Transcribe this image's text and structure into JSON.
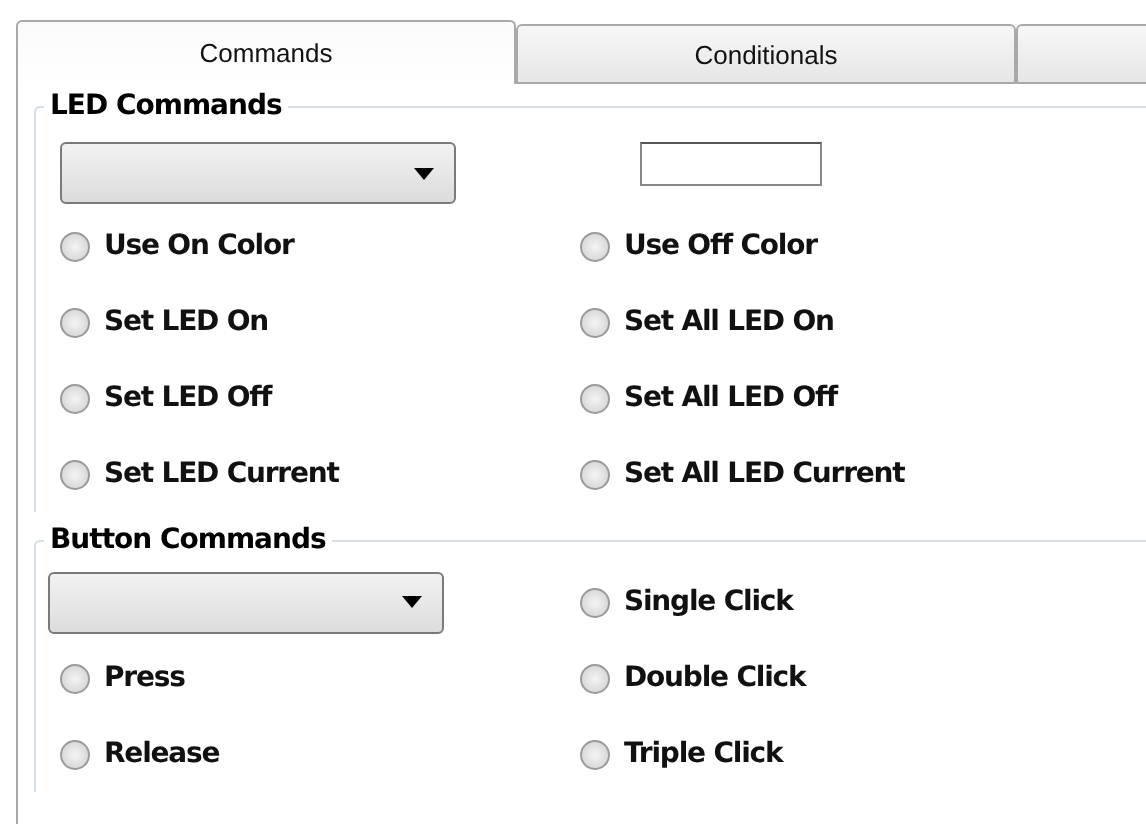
{
  "tabs": [
    {
      "label": "Commands",
      "selected": true
    },
    {
      "label": "Conditionals",
      "selected": false
    }
  ],
  "led_commands": {
    "title": "LED Commands",
    "options": [
      {
        "label": "Use On Color",
        "selected": false
      },
      {
        "label": "Use Off Color",
        "selected": false
      },
      {
        "label": "Set LED On",
        "selected": false
      },
      {
        "label": "Set All LED On",
        "selected": false
      },
      {
        "label": "Set LED Off",
        "selected": false
      },
      {
        "label": "Set All LED Off",
        "selected": false
      },
      {
        "label": "Set LED Current",
        "selected": false
      },
      {
        "label": "Set All LED Current",
        "selected": false
      }
    ]
  },
  "button_commands": {
    "title": "Button Commands",
    "options": [
      {
        "label": "Single Click",
        "selected": false
      },
      {
        "label": "Press",
        "selected": false
      },
      {
        "label": "Double Click",
        "selected": false
      },
      {
        "label": "Release",
        "selected": false
      },
      {
        "label": "Triple Click",
        "selected": false
      }
    ]
  }
}
